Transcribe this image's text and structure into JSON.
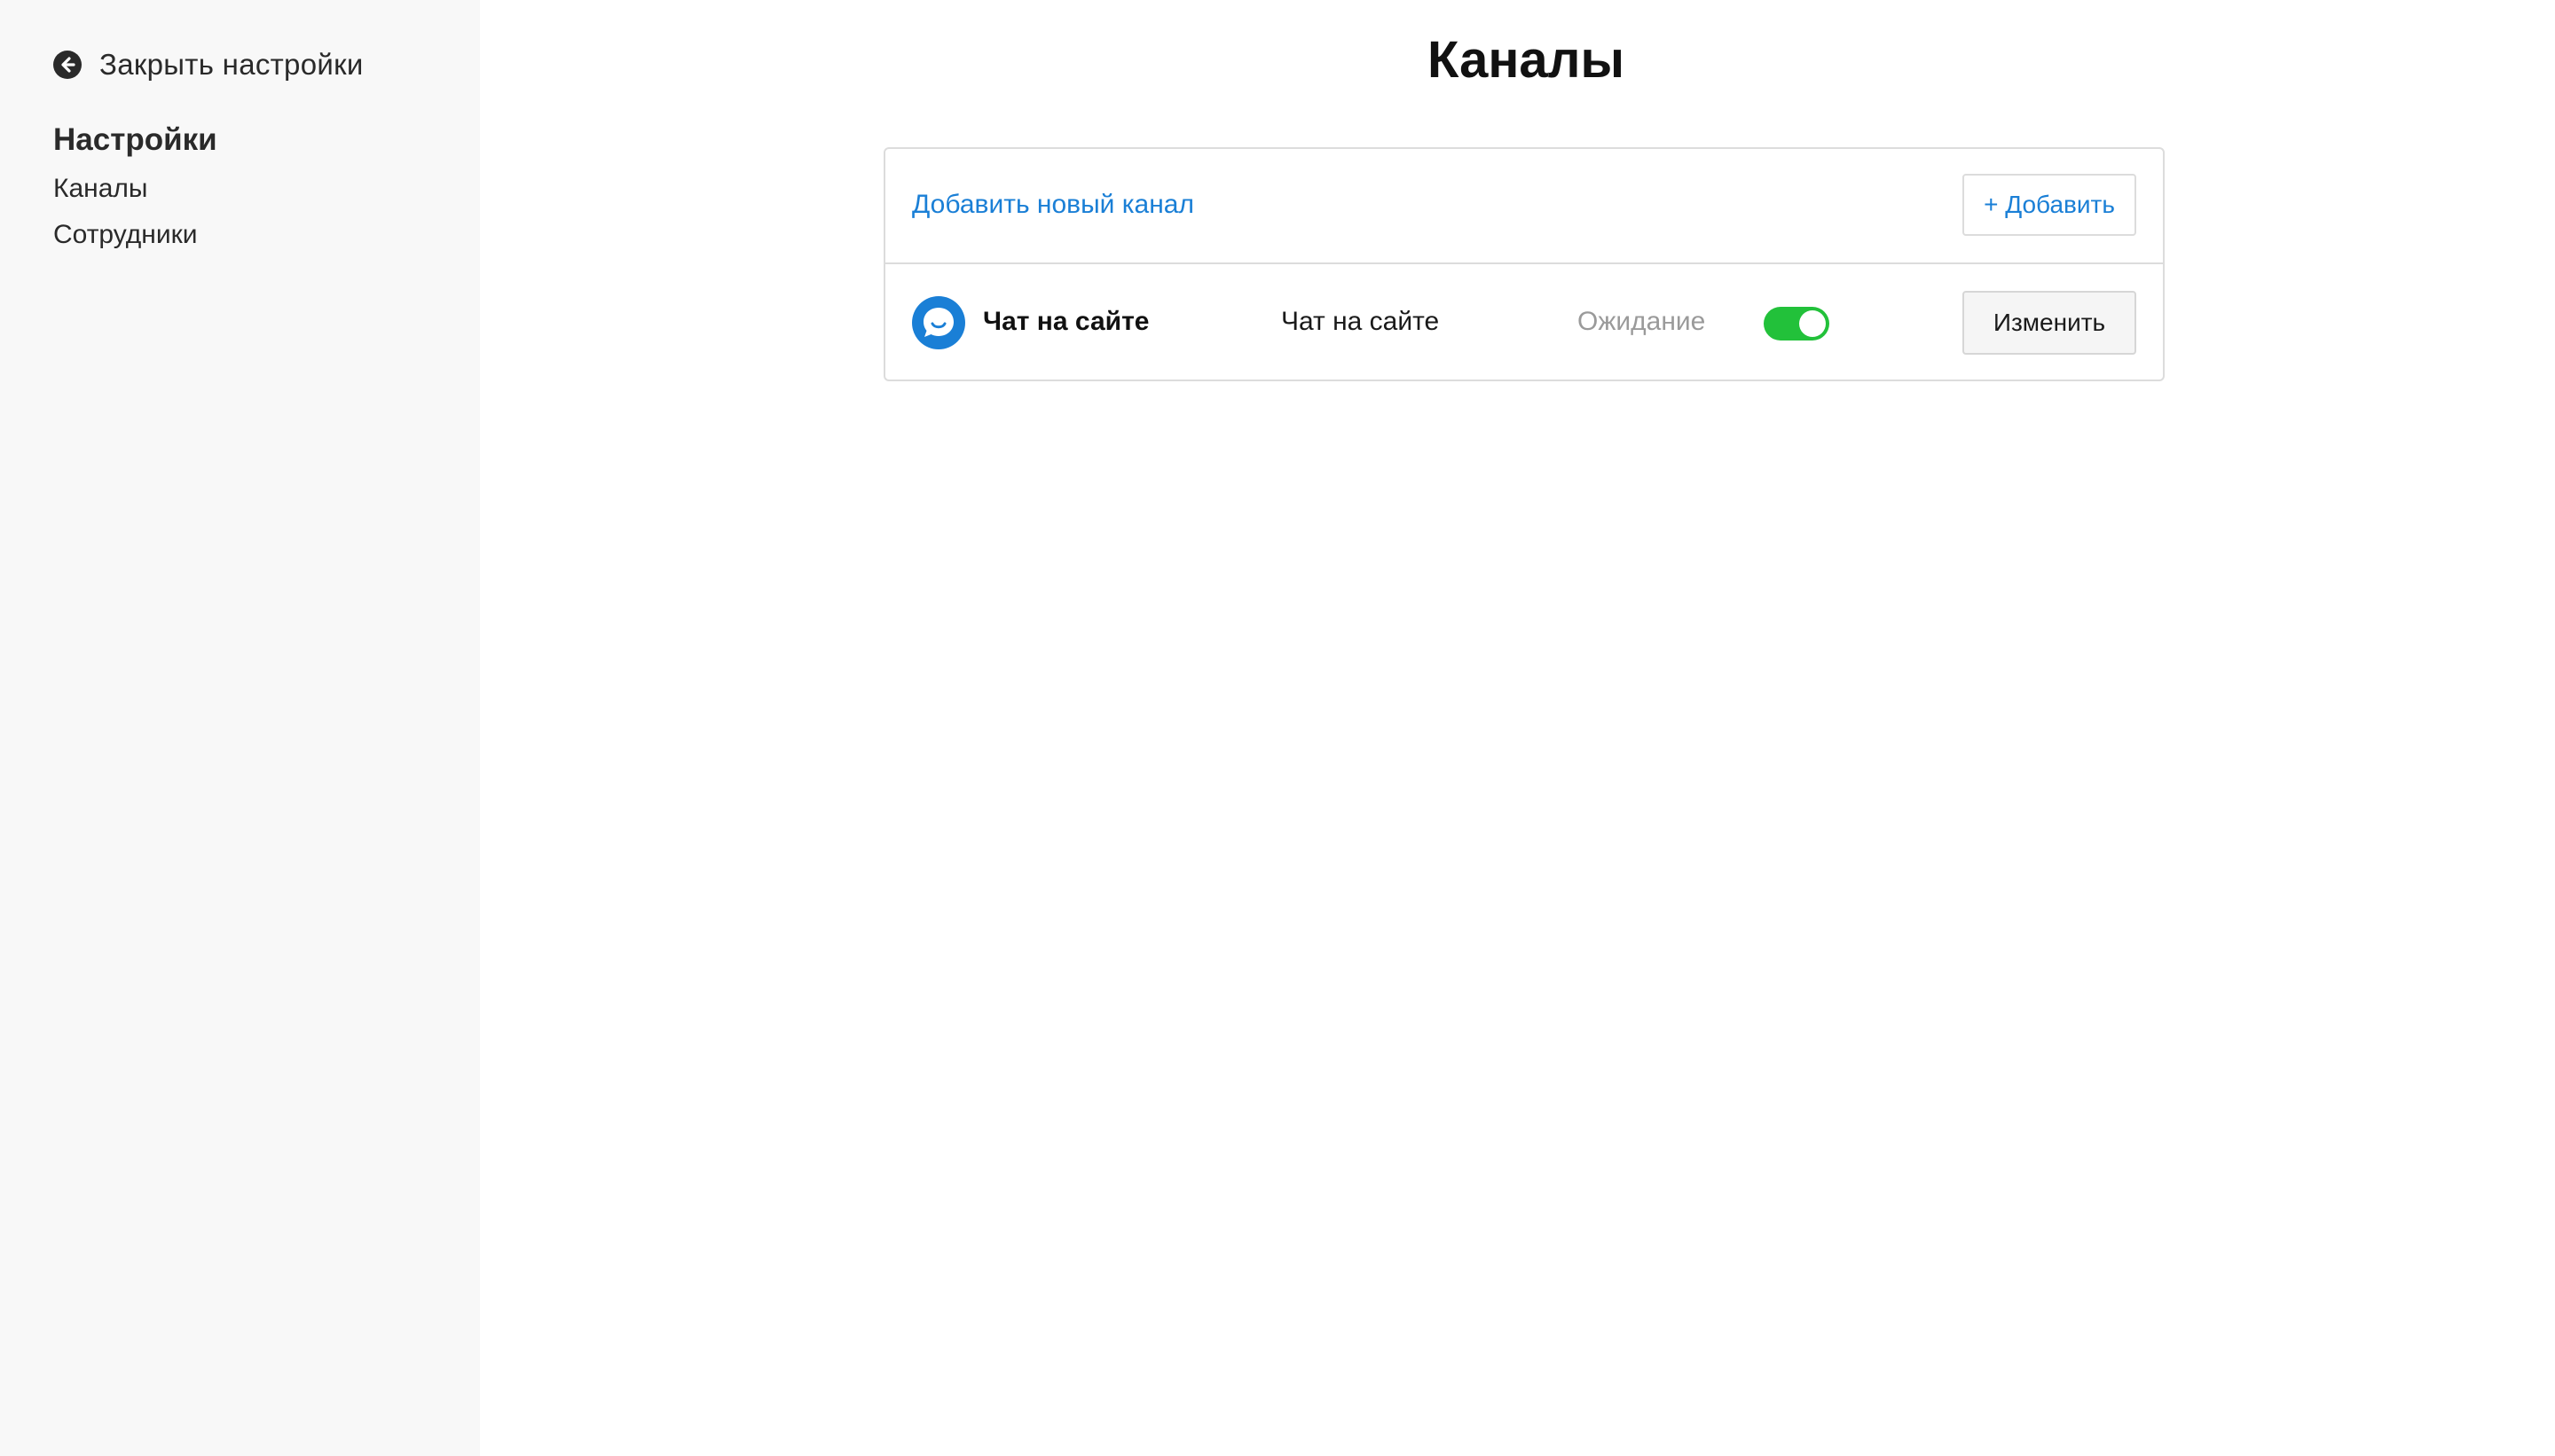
{
  "sidebar": {
    "close_label": "Закрыть настройки",
    "heading": "Настройки",
    "items": [
      {
        "label": "Каналы"
      },
      {
        "label": "Сотрудники"
      }
    ]
  },
  "main": {
    "title": "Каналы",
    "add_channel_link": "Добавить новый канал",
    "add_button_label": "+ Добавить",
    "channels": [
      {
        "name": "Чат на сайте",
        "type": "Чат на сайте",
        "status": "Ожидание",
        "enabled": true,
        "icon": "chat-bubble-icon",
        "edit_label": "Изменить"
      }
    ]
  },
  "colors": {
    "sidebar_bg": "#f8f8f8",
    "link_blue": "#1a7fd6",
    "toggle_on": "#22c13a",
    "avatar_blue": "#1a7fd6",
    "status_gray": "#9a9a9a"
  }
}
